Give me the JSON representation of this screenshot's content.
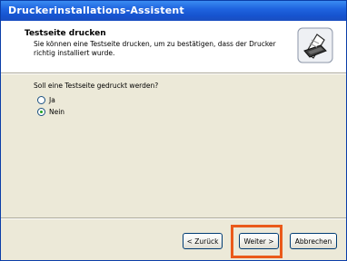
{
  "window": {
    "title": "Druckerinstallations-Assistent"
  },
  "header": {
    "title": "Testseite drucken",
    "description": "Sie können eine Testseite drucken, um zu bestätigen, dass der Drucker richtig installiert wurde.",
    "icon": "printer-icon"
  },
  "content": {
    "question": "Soll eine Testseite gedruckt werden?",
    "options": [
      {
        "label": "Ja",
        "checked": false
      },
      {
        "label": "Nein",
        "checked": true
      }
    ]
  },
  "buttons": {
    "back": "< Zurück",
    "next": "Weiter >",
    "cancel": "Abbrechen"
  },
  "colors": {
    "titlebar": "#1f64df",
    "highlight": "#ea5a1a",
    "dialog_bg": "#ece9d8"
  }
}
